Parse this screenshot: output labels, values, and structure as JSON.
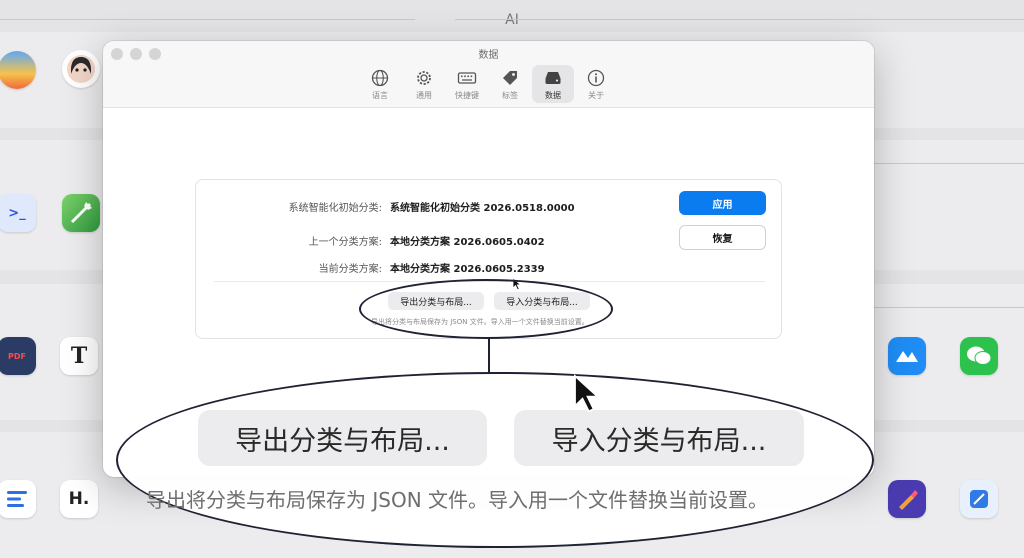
{
  "background": {
    "section_label": "AI",
    "apps": [
      {
        "name": "arc-app-icon",
        "glyph": ""
      },
      {
        "name": "avatar-app-icon",
        "glyph": ""
      },
      {
        "name": "terminal-app-icon",
        "glyph": ">_"
      },
      {
        "name": "maps-app-icon",
        "glyph": ""
      },
      {
        "name": "pdf-app-icon",
        "glyph": "PDF"
      },
      {
        "name": "typora-app-icon",
        "glyph": "T"
      },
      {
        "name": "lark-app-icon",
        "glyph": ""
      },
      {
        "name": "wechat-app-icon",
        "glyph": ""
      },
      {
        "name": "list-app-icon",
        "glyph": ""
      },
      {
        "name": "h-app-icon",
        "glyph": "H."
      },
      {
        "name": "brush-app-icon",
        "glyph": ""
      },
      {
        "name": "xcode-app-icon",
        "glyph": ""
      }
    ]
  },
  "window": {
    "title": "数据",
    "toolbar": [
      {
        "label": "语言",
        "icon": "globe-icon"
      },
      {
        "label": "通用",
        "icon": "gear-icon"
      },
      {
        "label": "快捷键",
        "icon": "keyboard-icon"
      },
      {
        "label": "标签",
        "icon": "tag-icon"
      },
      {
        "label": "数据",
        "icon": "drive-icon",
        "active": true
      },
      {
        "label": "关于",
        "icon": "info-icon"
      }
    ],
    "rows": [
      {
        "label": "系统智能化初始分类:",
        "value": "系统智能化初始分类 2026.0518.0000"
      },
      {
        "label": "上一个分类方案:",
        "value": "本地分类方案 2026.0605.0402"
      },
      {
        "label": "当前分类方案:",
        "value": "本地分类方案 2026.0605.2339"
      }
    ],
    "apply_label": "应用",
    "restore_label": "恢复",
    "export_label": "导出分类与布局...",
    "import_label": "导入分类与布局...",
    "hint": "导出将分类与布局保存为 JSON 文件。导入用一个文件替换当前设置。"
  },
  "zoom": {
    "export_label": "导出分类与布局...",
    "import_label": "导入分类与布局...",
    "hint": "导出将分类与布局保存为 JSON 文件。导入用一个文件替换当前设置。"
  },
  "colors": {
    "accent": "#0a7cf0",
    "callout_outline": "#1e2233"
  }
}
